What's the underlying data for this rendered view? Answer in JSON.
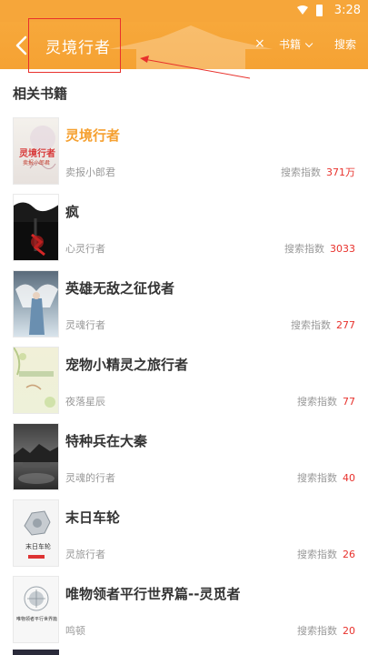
{
  "status_bar": {
    "time": "3:28"
  },
  "search": {
    "query": "灵境行者",
    "clear": "×",
    "category": "书籍",
    "submit": "搜索"
  },
  "section": {
    "title": "相关书籍"
  },
  "books": [
    {
      "title": "灵境行者",
      "author": "卖报小郎君",
      "index_label": "搜索指数",
      "index_value": "371万",
      "cover_title": "灵境行者",
      "cover_sub": "卖报小郎君"
    },
    {
      "title": "疯",
      "author": "心灵行者",
      "index_label": "搜索指数",
      "index_value": "3033"
    },
    {
      "title": "英雄无敌之征伐者",
      "author": "灵魂行者",
      "index_label": "搜索指数",
      "index_value": "277"
    },
    {
      "title": "宠物小精灵之旅行者",
      "author": "夜落星辰",
      "index_label": "搜索指数",
      "index_value": "77"
    },
    {
      "title": "特种兵在大秦",
      "author": "灵魂的行者",
      "index_label": "搜索指数",
      "index_value": "40"
    },
    {
      "title": "末日车轮",
      "author": "灵旅行者",
      "index_label": "搜索指数",
      "index_value": "26",
      "cover_title": "末日车轮"
    },
    {
      "title": "唯物领者平行世界篇--灵觅者",
      "author": "鸣顿",
      "index_label": "搜索指数",
      "index_value": "20",
      "cover_title": "唯物领者平行世界篇"
    }
  ],
  "colors": {
    "header": "#f6a63a",
    "highlight_title": "#f5a030",
    "index_number": "#e8312c",
    "annotation": "#e8312c"
  }
}
